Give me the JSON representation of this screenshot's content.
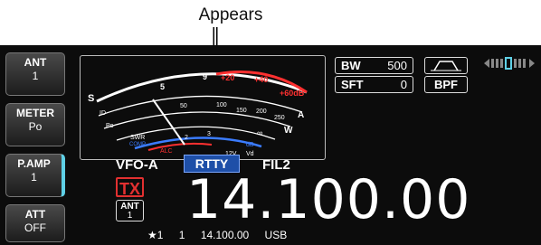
{
  "callout": {
    "label": "Appears"
  },
  "sidebar": {
    "ant": {
      "label": "ANT",
      "value": "1"
    },
    "meter": {
      "label": "METER",
      "value": "Po"
    },
    "pamp": {
      "label": "P.AMP",
      "value": "1"
    },
    "att": {
      "label": "ATT",
      "value": "OFF"
    }
  },
  "meter": {
    "s_scale": [
      "1",
      "5",
      "9"
    ],
    "s_plus": [
      "+20",
      "+40",
      "+60dB"
    ],
    "po_scale": [
      "0",
      "50",
      "100",
      "150",
      "200",
      "250"
    ],
    "swr_scale": [
      "1",
      "1.5",
      "2",
      "3",
      "∞"
    ],
    "alc_label": "ALC",
    "comp_label": "COMP",
    "db_label": "dB",
    "vd_labels": [
      "13.8V",
      "16V"
    ],
    "id_scale": [
      "0",
      "5",
      "10",
      "15",
      "20",
      "25"
    ],
    "row_labels": {
      "s": "S",
      "id": "ID",
      "po": "Po",
      "swr": "SWR",
      "comp": "COMP",
      "w": "W",
      "a": "A",
      "vd": "Vd"
    },
    "extra": {
      "v5": "5",
      "v10": "10",
      "v12": "12V"
    }
  },
  "filter": {
    "bw_label": "BW",
    "bw_value": "500",
    "sft_label": "SFT",
    "sft_value": "0",
    "bpf_label": "BPF"
  },
  "display": {
    "vfo": "VFO-A",
    "mode": "RTTY",
    "fil": "FIL2",
    "tx": "TX",
    "ant_label": "ANT",
    "ant_value": "1",
    "frequency": "14.100.00"
  },
  "bottom": {
    "star": "★1",
    "channel": "1",
    "freq": "14.100.00",
    "mode": "USB"
  }
}
